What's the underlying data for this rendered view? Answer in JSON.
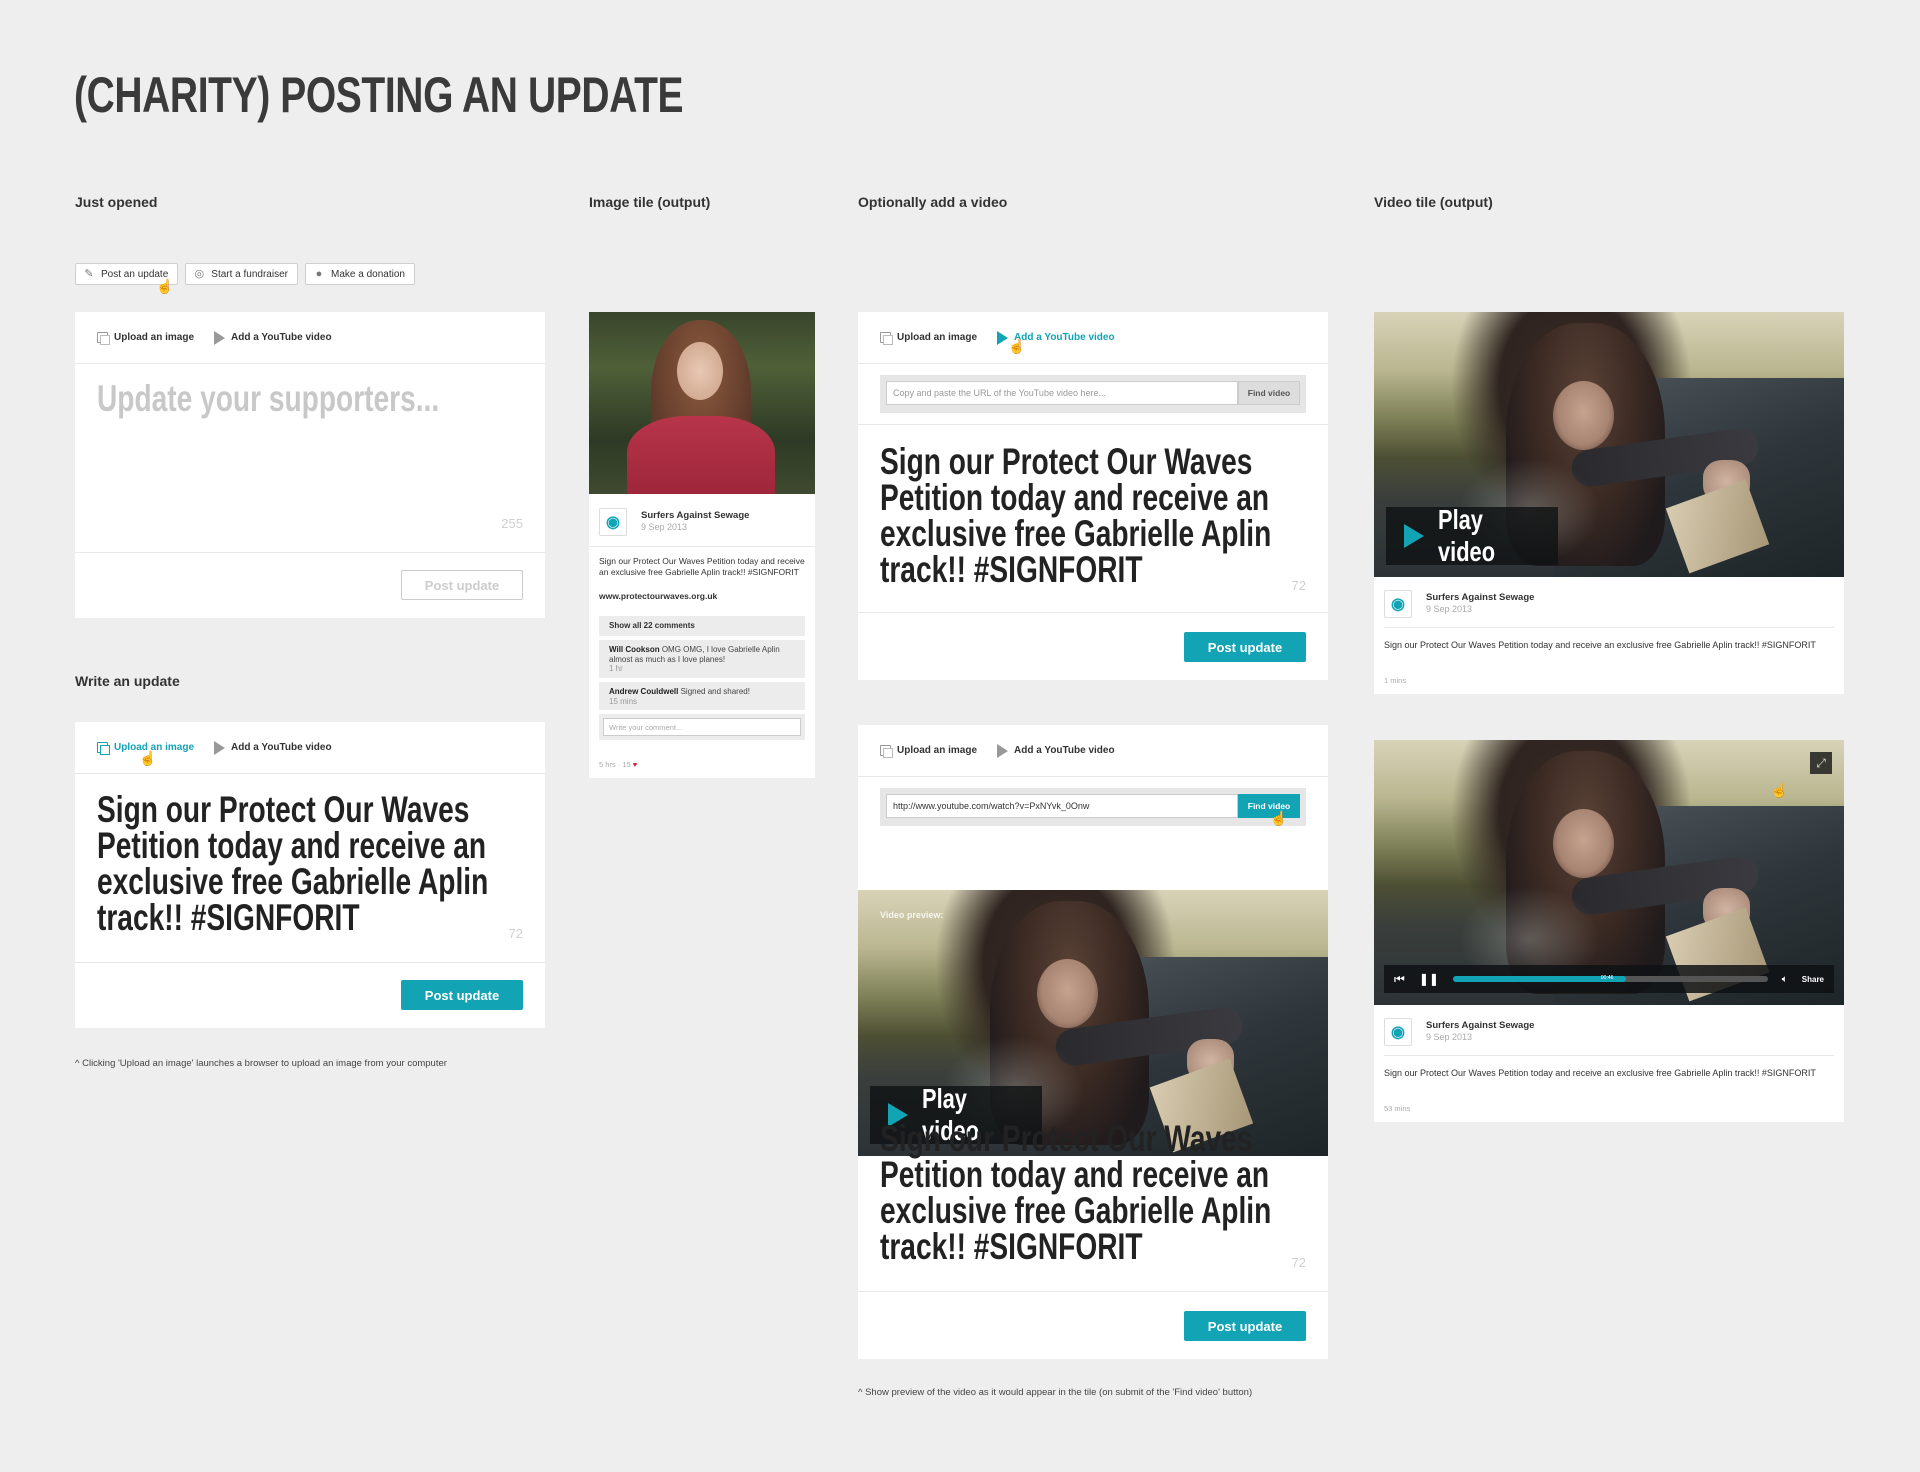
{
  "page_title": "(CHARITY) POSTING AN UPDATE",
  "columns": {
    "just_opened": "Just opened",
    "image_tile": "Image tile (output)",
    "optionally_add_video": "Optionally add a video",
    "video_tile": "Video tile (output)",
    "write_update": "Write an update"
  },
  "tabs": {
    "post_update": "Post an update",
    "start_fundraiser": "Start a fundraiser",
    "make_donation": "Make a donation"
  },
  "toolbar": {
    "upload_image": "Upload an image",
    "add_youtube": "Add a YouTube video"
  },
  "composer": {
    "placeholder": "Update your supporters...",
    "empty_count": "255",
    "post_label": "Post update",
    "message": "Sign our Protect Our Waves Petition today and receive an exclusive free Gabrielle Aplin track!! #SIGNFORIT",
    "count": "72"
  },
  "video_form": {
    "url_placeholder": "Copy and paste the URL of the YouTube video here...",
    "url_value": "http://www.youtube.com/watch?v=PxNYvk_0Onw",
    "find_label": "Find video",
    "preview_label": "Video preview:",
    "play_label": "Play video"
  },
  "image_tile": {
    "org": "Surfers Against Sewage",
    "date": "9 Sep 2013",
    "body": "Sign our Protect Our Waves Petition today and receive an exclusive free Gabrielle Aplin track!! #SIGNFORIT",
    "link": "www.protectourwaves.org.uk",
    "show_comments": "Show all 22 comments",
    "comment1_author": "Will Cookson",
    "comment1_text": "OMG OMG, I love Gabrielle Aplin almost as much as I love planes!",
    "comment1_time": "1 hr",
    "comment2_author": "Andrew Couldwell",
    "comment2_text": "Signed and shared!",
    "comment2_time": "15 mins",
    "comment_placeholder": "Write your comment...",
    "meta": "5 hrs · 15"
  },
  "video_tile": {
    "org": "Surfers Against Sewage",
    "date": "9 Sep 2013",
    "body": "Sign our Protect Our Waves Petition today and receive an exclusive free Gabrielle Aplin track!! #SIGNFORIT",
    "time1": "1 mins",
    "time2": "53 mins",
    "share_label": "Share",
    "progress_time": "00:46",
    "progress": 0.55
  },
  "footnotes": {
    "upload": "^  Clicking 'Upload an image' launches a browser to upload an image from your computer",
    "preview": "^  Show preview of the video as it would appear in the tile (on submit of the 'Find video' button)"
  },
  "colors": {
    "accent": "#12a3b4",
    "background": "#eeeeee"
  },
  "icons": [
    "pencil-icon",
    "medal-icon",
    "piggy-bank-icon",
    "image-icon",
    "play-icon",
    "hand-cursor-icon",
    "fullscreen-icon",
    "mute-icon",
    "pause-icon",
    "skip-back-icon",
    "heart-icon",
    "surf-logo-icon"
  ]
}
